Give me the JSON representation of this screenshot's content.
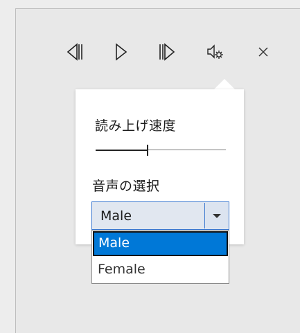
{
  "toolbar": {
    "previous_icon": "skip-previous-icon",
    "play_icon": "play-icon",
    "next_icon": "skip-next-icon",
    "settings_icon": "voice-settings-icon",
    "close_icon": "close-icon"
  },
  "popup": {
    "speed_label": "読み上げ速度",
    "speed_value": 0.4,
    "voice_label": "音声の選択",
    "voice_selected": "Male",
    "voice_options": [
      "Male",
      "Female"
    ]
  },
  "colors": {
    "accent": "#0078d7",
    "combo_border": "#3a77cf",
    "background": "#ededed"
  }
}
